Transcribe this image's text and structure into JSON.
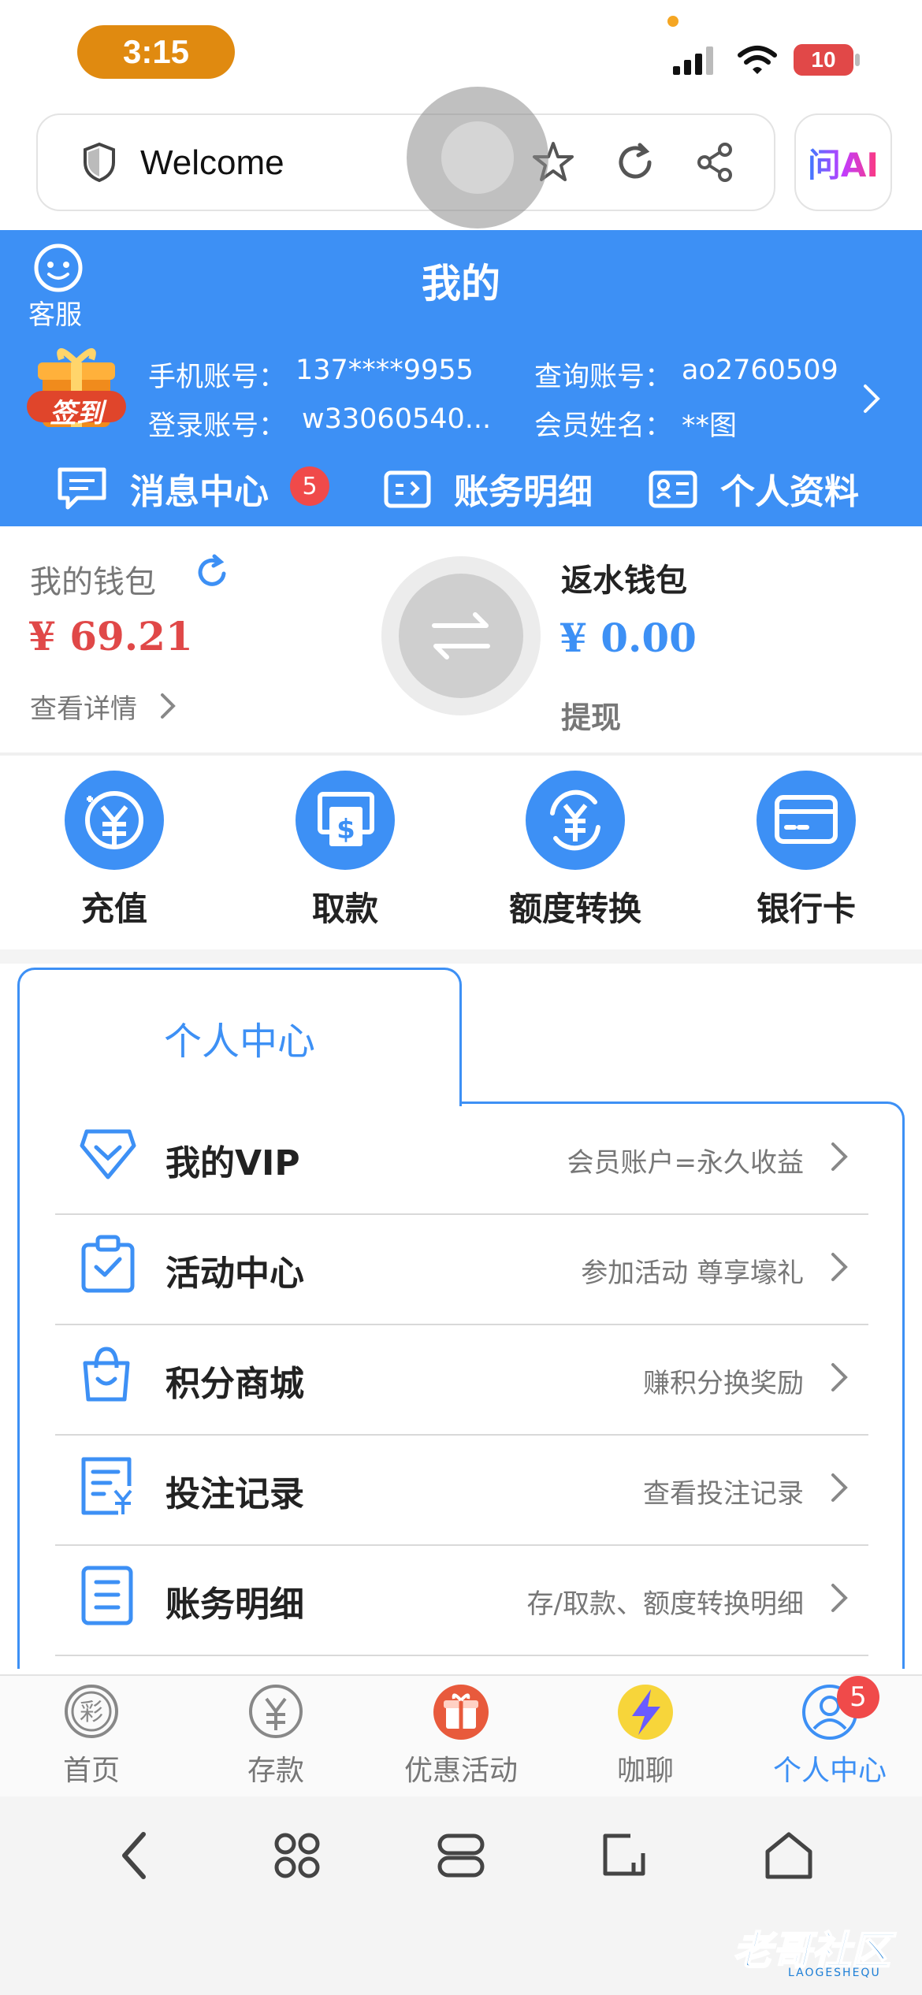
{
  "status_bar": {
    "time": "3:15",
    "battery": "10"
  },
  "browser": {
    "page_title": "Welcome",
    "ai_button": "问AI"
  },
  "header": {
    "title": "我的",
    "customer_service": "客服",
    "checkin_badge": "签到",
    "account": {
      "phone_label": "手机账号：",
      "phone_value": "137****9955",
      "query_label": "查询账号：",
      "query_value": "ao2760509",
      "login_label": "登录账号：",
      "login_value": "w33060540...",
      "name_label": "会员姓名：",
      "name_value": "**图"
    },
    "nav": [
      {
        "label": "消息中心",
        "badge": "5"
      },
      {
        "label": "账务明细"
      },
      {
        "label": "个人资料"
      }
    ]
  },
  "wallet": {
    "main_label": "我的钱包",
    "main_amount": "¥ 69.21",
    "details_link": "查看详情",
    "rebate_label": "返水钱包",
    "rebate_amount": "¥ 0.00",
    "withdraw_label": "提现"
  },
  "quick_actions": [
    {
      "label": "充值",
      "icon": "recharge-icon"
    },
    {
      "label": "取款",
      "icon": "atm-icon"
    },
    {
      "label": "额度转换",
      "icon": "yuan-transfer-icon"
    },
    {
      "label": "银行卡",
      "icon": "bank-card-icon"
    }
  ],
  "personal_center": {
    "tab_label": "个人中心",
    "rows": [
      {
        "title": "我的VIP",
        "desc": "会员账户=永久收益",
        "icon": "vip-diamond-icon"
      },
      {
        "title": "活动中心",
        "desc": "参加活动 尊享壕礼",
        "icon": "activity-clipboard-icon"
      },
      {
        "title": "积分商城",
        "desc": "赚积分换奖励",
        "icon": "shopping-bag-icon"
      },
      {
        "title": "投注记录",
        "desc": "查看投注记录",
        "icon": "bet-record-icon"
      },
      {
        "title": "账务明细",
        "desc": "存/取款、额度转换明细",
        "icon": "ledger-icon"
      }
    ]
  },
  "tab_bar": {
    "items": [
      {
        "label": "首页",
        "icon": "lottery-icon"
      },
      {
        "label": "存款",
        "icon": "yuan-icon"
      },
      {
        "label": "优惠活动",
        "icon": "gift-icon"
      },
      {
        "label": "咖聊",
        "icon": "lightning-icon"
      },
      {
        "label": "个人中心",
        "icon": "user-icon",
        "badge": "5"
      }
    ]
  },
  "watermark": {
    "text": "老哥社区",
    "sub": "LAOGESHEQU"
  },
  "colors": {
    "primary": "#3d90f5",
    "money_red": "#e04848",
    "badge_red": "#f04a4a",
    "time_pill": "#e08a10"
  }
}
